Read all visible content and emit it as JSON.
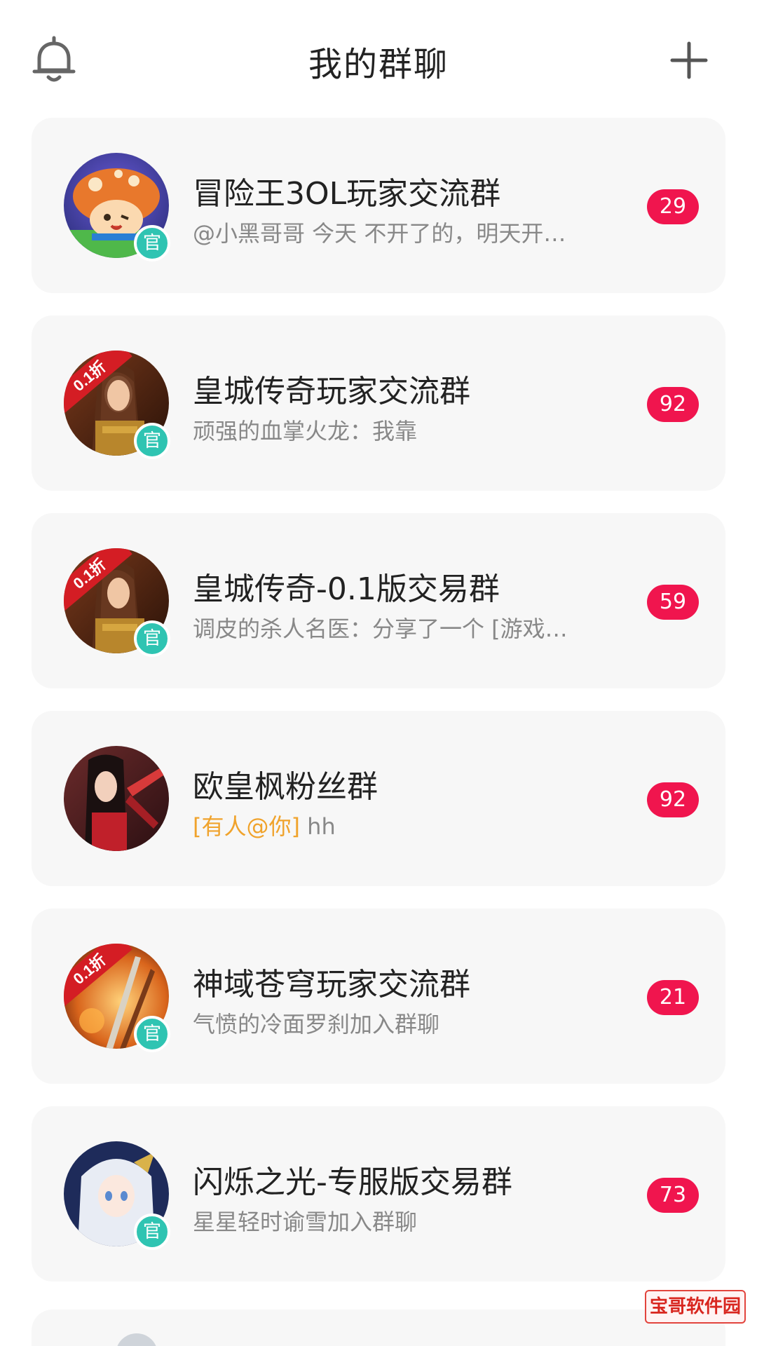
{
  "header": {
    "title": "我的群聊",
    "left_icon": "bell-icon",
    "right_icon": "plus-icon"
  },
  "groups": [
    {
      "name": "冒险王3OL玩家交流群",
      "preview": "@小黑哥哥 今天 不开了的，明天开…",
      "unread": "29",
      "official_label": "官",
      "avatar": "mushroom-mascot"
    },
    {
      "name": "皇城传奇玩家交流群",
      "preview": "顽强的血掌火龙：我靠",
      "unread": "92",
      "official_label": "官",
      "ribbon": "0.1折",
      "avatar": "warrior-woman"
    },
    {
      "name": "皇城传奇-0.1版交易群",
      "preview": "调皮的杀人名医：分享了一个 [游戏…",
      "unread": "59",
      "official_label": "官",
      "ribbon": "0.1折",
      "avatar": "warrior-woman"
    },
    {
      "name": "欧皇枫粉丝群",
      "mention": "[有人@你]",
      "preview": " hh",
      "unread": "92",
      "avatar": "dark-hair-swordswoman"
    },
    {
      "name": "神域苍穹玩家交流群",
      "preview": "气愤的冷面罗刹加入群聊",
      "unread": "21",
      "official_label": "官",
      "ribbon": "0.1折",
      "avatar": "fire-sword"
    },
    {
      "name": "闪烁之光-专服版交易群",
      "preview": "星星轻时谕雪加入群聊",
      "unread": "73",
      "official_label": "官",
      "avatar": "silver-hair-girl"
    }
  ],
  "watermark": "宝哥软件园",
  "colors": {
    "badge": "#f0154e",
    "official": "#2fc4b2",
    "mention": "#f0a32c",
    "card_bg": "#f7f7f7",
    "ribbon": "#d41d24"
  }
}
